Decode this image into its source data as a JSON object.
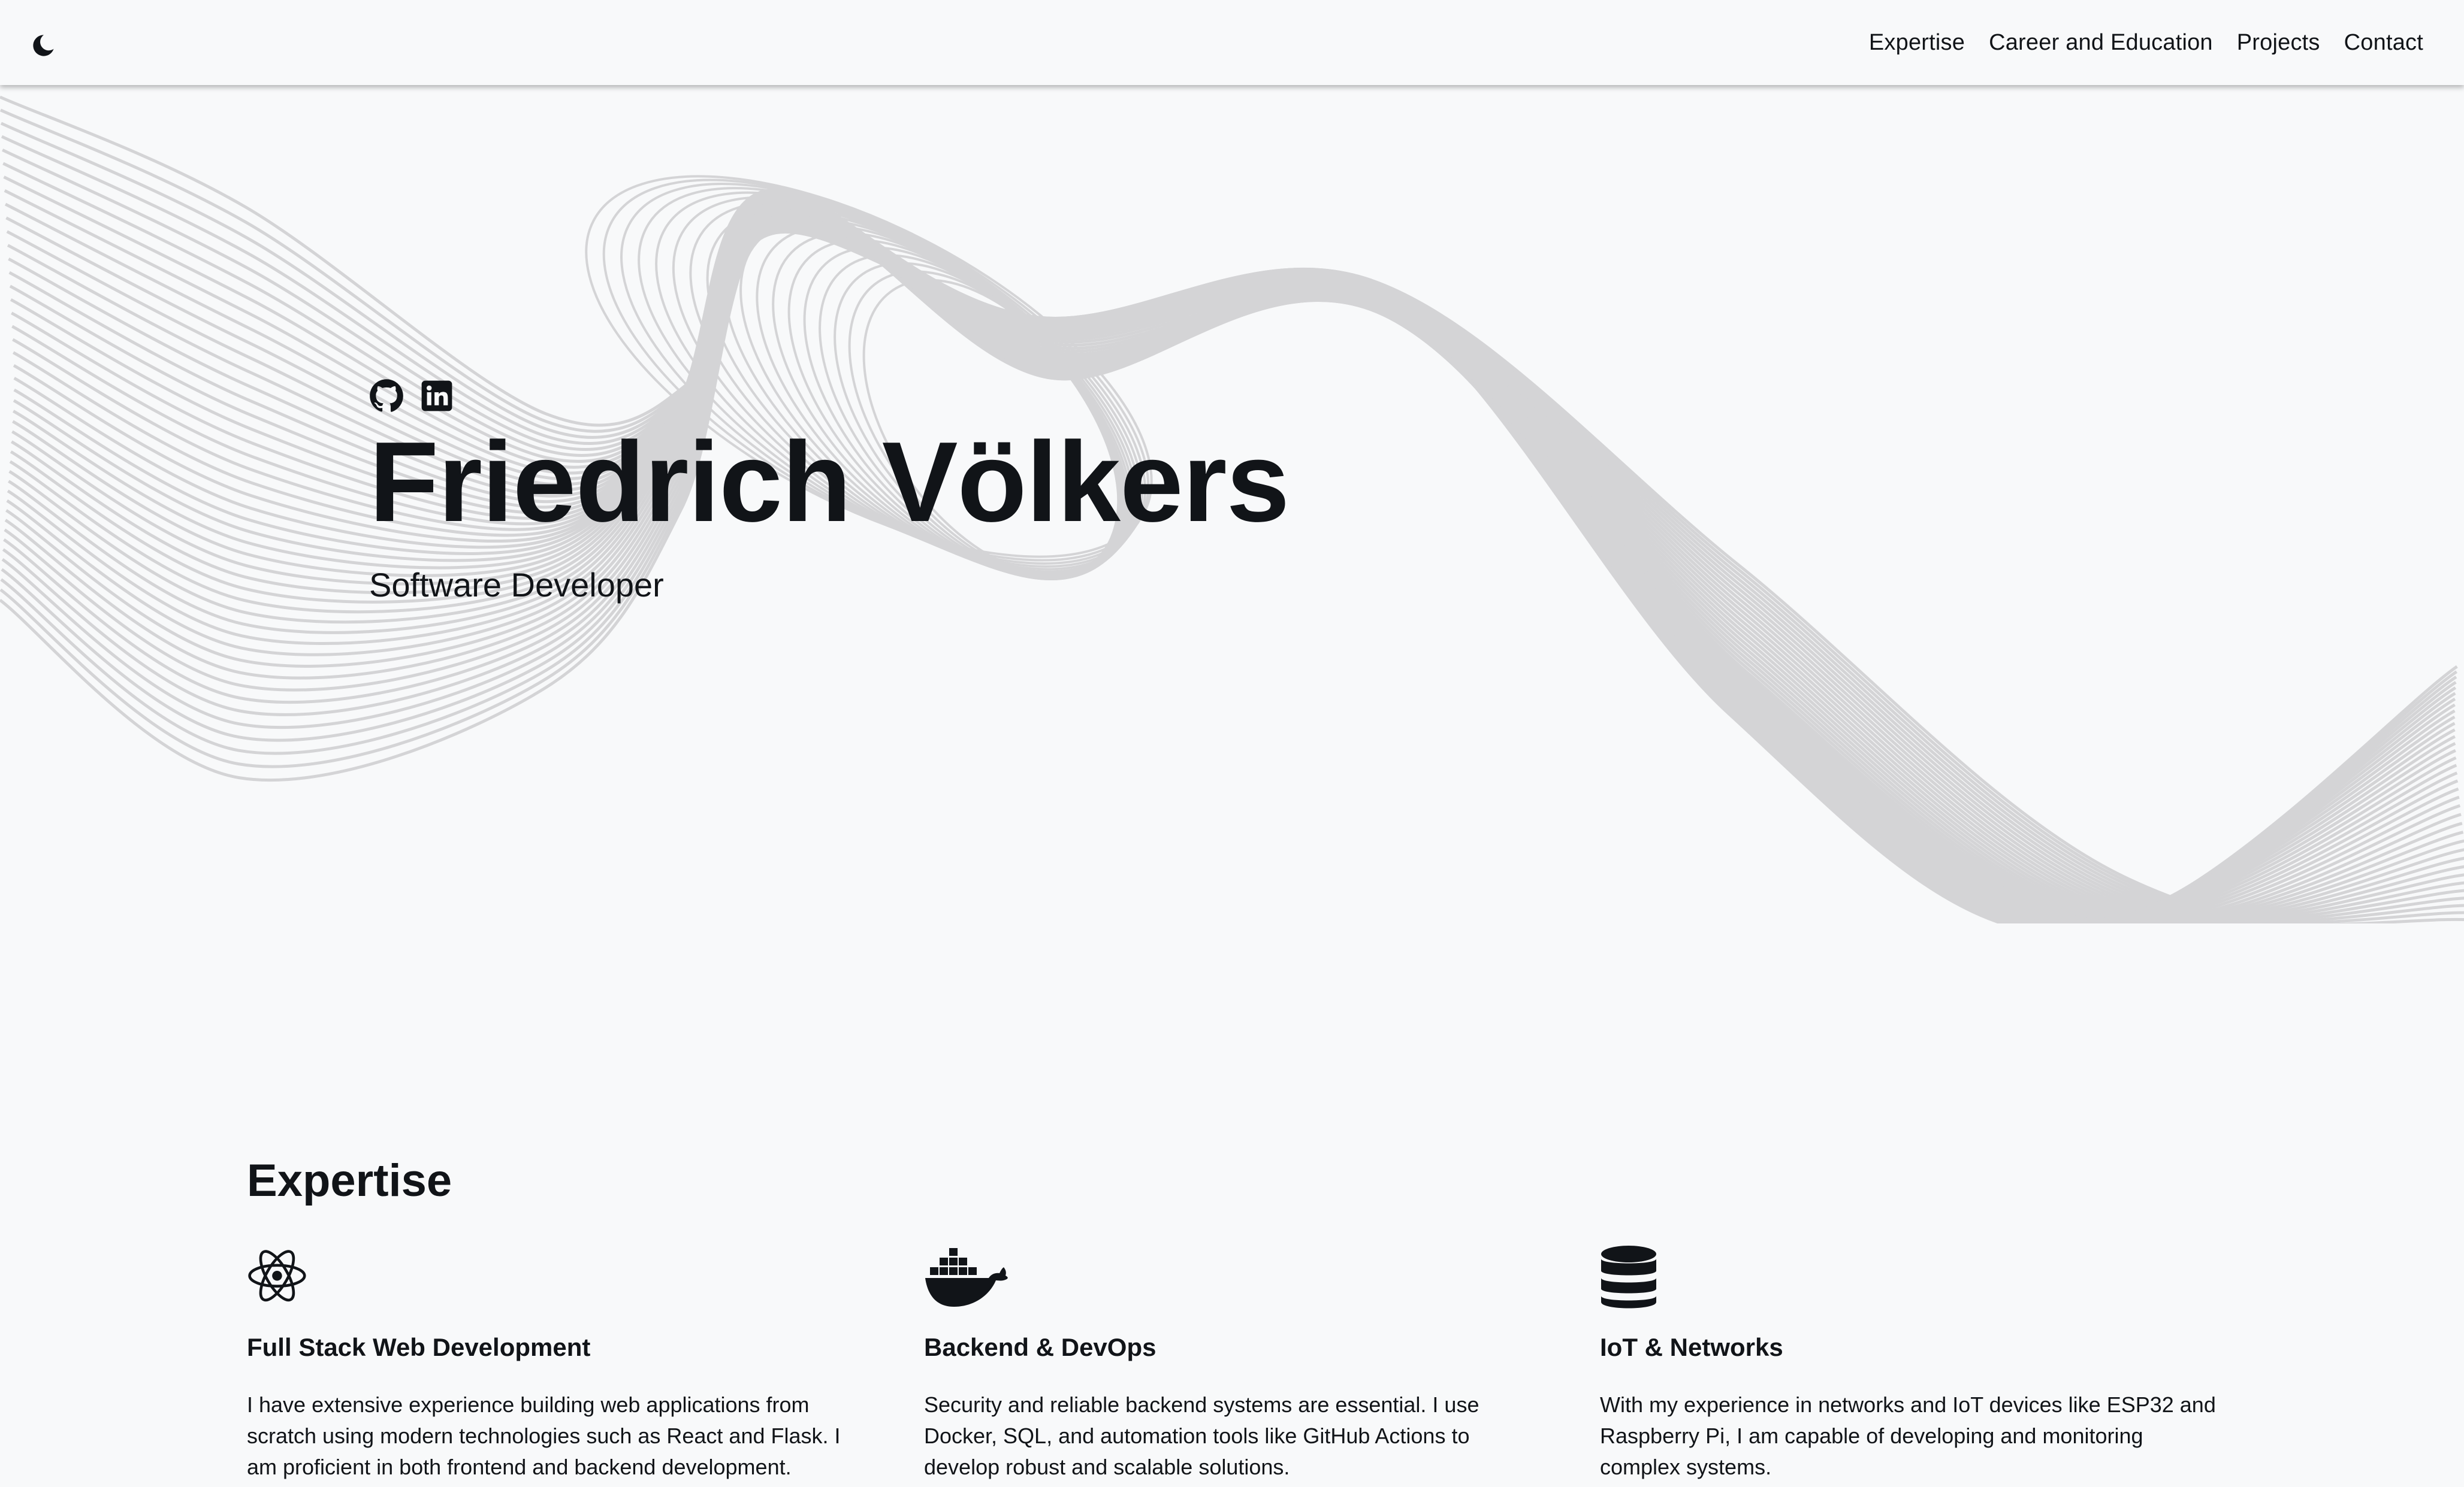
{
  "navbar": {
    "theme_toggle_icon": "moon-icon",
    "links": [
      "Expertise",
      "Career and Education",
      "Projects",
      "Contact"
    ]
  },
  "hero": {
    "social": [
      {
        "icon": "github-icon",
        "label": "GitHub"
      },
      {
        "icon": "linkedin-icon",
        "label": "LinkedIn"
      }
    ],
    "name": "Friedrich Völkers",
    "subtitle": "Software Developer"
  },
  "expertise": {
    "title": "Expertise",
    "items": [
      {
        "icon": "react-icon",
        "title": "Full Stack Web Development",
        "text": "I have extensive experience building web applications from scratch using modern technologies such as React and Flask. I am proficient in both frontend and backend development."
      },
      {
        "icon": "docker-icon",
        "title": "Backend & DevOps",
        "text": "Security and reliable backend systems are essential. I use Docker, SQL, and automation tools like GitHub Actions to develop robust and scalable solutions."
      },
      {
        "icon": "database-icon",
        "title": "IoT & Networks",
        "text": "With my experience in networks and IoT devices like ESP32 and Raspberry Pi, I am capable of developing and monitoring complex systems."
      }
    ]
  },
  "colors": {
    "background": "#f8f9fa",
    "text": "#111418",
    "wave_lines": "#d4d4d6"
  }
}
